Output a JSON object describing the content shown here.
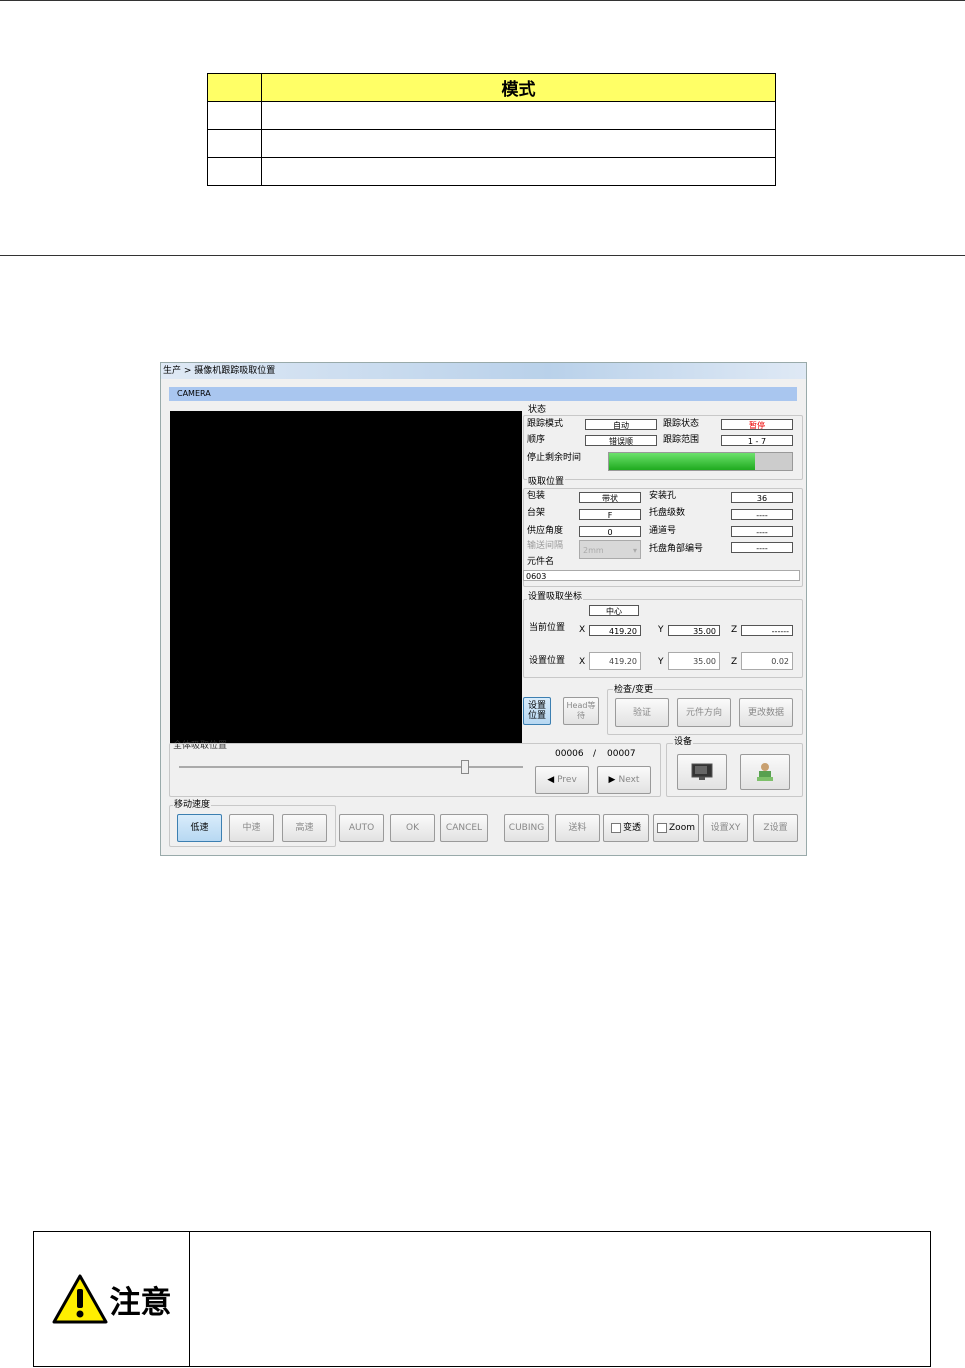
{
  "mode_table": {
    "header": [
      "",
      "模式"
    ],
    "rows": [
      [
        "",
        ""
      ],
      [
        "",
        ""
      ],
      [
        "",
        ""
      ]
    ]
  },
  "window": {
    "breadcrumb": "生产 > 摄像机跟踪吸取位置",
    "camera_label": "CAMERA",
    "status": {
      "title": "状态",
      "track_mode_label": "跟踪模式",
      "track_mode": "自动",
      "track_state_label": "跟踪状态",
      "track_state": "暂停",
      "order_label": "顺序",
      "order": "错误顺",
      "track_range_label": "跟踪范围",
      "track_range": "1 - 7",
      "stop_remaining_label": "停止剩余时间",
      "stop_remaining_progress": 0.8
    },
    "pickup": {
      "title": "吸取位置",
      "package_label": "包装",
      "package": "带状",
      "mount_hole_label": "安装孔",
      "mount_hole": "36",
      "table_label": "台架",
      "table": "F",
      "tray_layers_label": "托盘级数",
      "tray_layers": "----",
      "feed_angle_label": "供应角度",
      "feed_angle": "0",
      "channel_label": "通道号",
      "channel": "----",
      "feed_pitch_label": "输送间隔",
      "feed_pitch": "2mm",
      "tray_corner_label": "托盘角部编号",
      "tray_corner": "----",
      "part_name_label": "元件名",
      "part_name": "0603"
    },
    "coords": {
      "title": "设置吸取坐标",
      "center": "中心",
      "current_label": "当前位置",
      "current_x": "419.20",
      "current_y": "35.00",
      "current_z": "------",
      "set_label": "设置位置",
      "set_x": "419.20",
      "set_y": "35.00",
      "set_z": "0.02",
      "x": "X",
      "y": "Y",
      "z": "Z"
    },
    "set_position_btn": "设置位置",
    "head_wait_btn": "Head等待",
    "inspect": {
      "title": "检查/变更",
      "verify": "验证",
      "part_dir": "元件方向",
      "change_data": "更改数据"
    },
    "slider_label": "全体吸取位置",
    "counter": {
      "current": "00006",
      "sep": "/",
      "total": "00007"
    },
    "prev": "Prev",
    "next": "Next",
    "devices_title": "设备",
    "speed": {
      "title": "移动速度",
      "low": "低速",
      "mid": "中速",
      "high": "高速"
    },
    "bottom_buttons": {
      "auto": "AUTO",
      "ok": "OK",
      "cancel": "CANCEL",
      "cubing": "CUBING",
      "feed": "送料",
      "transparent": "变透",
      "zoom": "Zoom",
      "set_xy": "设置XY",
      "z_set": "Z设置"
    }
  },
  "caution": {
    "label": "注意"
  }
}
